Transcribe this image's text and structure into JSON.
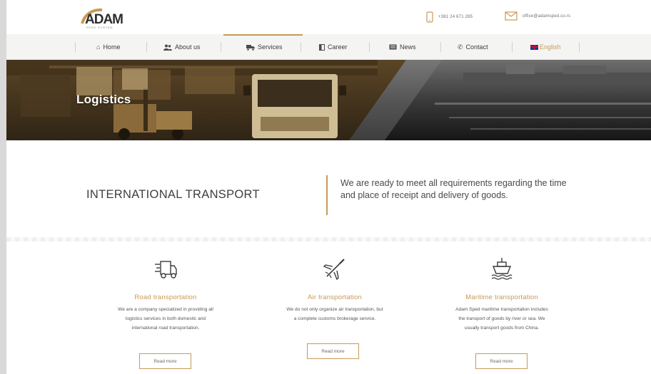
{
  "brand": {
    "logo_text": "ADAM",
    "logo_subtext": "SPED SYSTEM",
    "accent_color": "#c79a57"
  },
  "header": {
    "phone": "+381 24 671 285",
    "email": "office@adamsped.co.rs"
  },
  "nav": {
    "items": [
      {
        "label": "Home",
        "icon": "home-icon"
      },
      {
        "label": "About us",
        "icon": "users-icon"
      },
      {
        "label": "Services",
        "icon": "truck-icon",
        "active": true
      },
      {
        "label": "Career",
        "icon": "briefcase-icon"
      },
      {
        "label": "News",
        "icon": "newspaper-icon"
      },
      {
        "label": "Contact",
        "icon": "phone-icon"
      },
      {
        "label": "English",
        "icon": "uk-flag-icon"
      }
    ]
  },
  "hero": {
    "title": "Logistics"
  },
  "intro": {
    "heading": "INTERNATIONAL TRANSPORT",
    "text": "We are ready to meet all requirements regarding the time and place of receipt and delivery of goods."
  },
  "services": [
    {
      "icon": "delivery-truck-icon",
      "title": "Road transportation",
      "lines": [
        "We are a company specialized in providing all",
        "logistics services in both domestic and",
        "international road transportation."
      ],
      "cta": "Read more"
    },
    {
      "icon": "airplane-icon",
      "title": "Air transportation",
      "lines": [
        "We do not only organize air transportation, but",
        "a complete customs brokerage service."
      ],
      "cta": "Read more"
    },
    {
      "icon": "ship-icon",
      "title": "Maritime transportation",
      "lines": [
        "Adam Sped maritime transportation includes",
        "the transport of goods by river or sea. We",
        "usually transport goods from China."
      ],
      "cta": "Read more"
    }
  ]
}
